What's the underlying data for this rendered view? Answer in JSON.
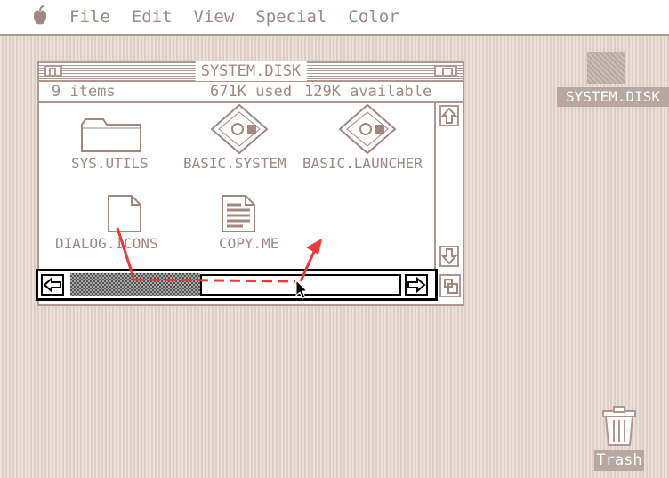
{
  "menubar": {
    "apple_icon": "apple-icon",
    "items": [
      "File",
      "Edit",
      "View",
      "Special",
      "Color"
    ]
  },
  "window": {
    "title": "SYSTEM.DISK",
    "info": {
      "items": "9 items",
      "used": "671K used",
      "available": "129K available"
    },
    "icons": [
      {
        "label": "SYS.UTILS",
        "icon": "folder-icon"
      },
      {
        "label": "BASIC.SYSTEM",
        "icon": "application-icon"
      },
      {
        "label": "BASIC.LAUNCHER",
        "icon": "application-icon"
      },
      {
        "label": "DIALOG.ICONS",
        "icon": "document-icon"
      },
      {
        "label": "COPY.ME",
        "icon": "text-document-icon"
      }
    ]
  },
  "desktop": {
    "disk": {
      "label": "SYSTEM.DISK",
      "icon": "disk-icon"
    },
    "trash": {
      "label": "Trash",
      "icon": "trash-icon"
    }
  },
  "annotation": {
    "color": "#e83a3a"
  },
  "colors": {
    "ink": "#a08880",
    "desktop": "#ddcfc6",
    "scrollbar_outline": "#000000"
  }
}
